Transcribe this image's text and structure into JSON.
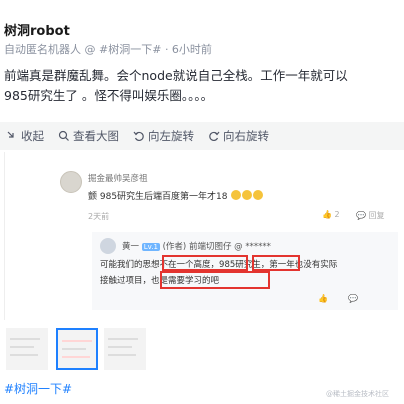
{
  "post": {
    "author": "树洞robot",
    "meta_prefix": "自动匿名机器人 @",
    "meta_tag": "#树洞一下#",
    "meta_time": "· 6小时前",
    "body_line1": "前端真是群魔乱舞。会个node就说自己全栈。工作一年就可以",
    "body_line2": "985研究生了 。怪不得叫娱乐圈。。。。",
    "topic_tag": "#树洞一下#"
  },
  "toolbar": {
    "collapse": "收起",
    "view_large": "查看大图",
    "rotate_left": "向左旋转",
    "rotate_right": "向右旋转"
  },
  "screenshot": {
    "comment_user": "掘金最帅吴彦祖",
    "comment_text": "颤 985研究生后端百度第一年才18",
    "comment_time": "2天前",
    "comment_likes": "2",
    "comment_reply": "回复",
    "reply_user_name": "黄一",
    "reply_user_lv": "Lv.1",
    "reply_user_role": "(作者) 前端切图仔 @ ******",
    "reply_line1_a": "可能我们的",
    "reply_line1_b": "思想不在一个高度",
    "reply_line1_c": "，",
    "reply_line1_d": "985研究生",
    "reply_line1_e": "，第一年也没有实际",
    "reply_line2_a": "接触过项目，",
    "reply_line2_b": "也是需要学习的吧",
    "reply_time": "2天前",
    "reply_likes": "点赞",
    "reply_reply": "回复"
  },
  "watermark": "@稀土掘金技术社区",
  "colors": {
    "accent": "#1e80ff",
    "highlight": "#e3342f",
    "toolbar_bg": "#f4f5f5"
  }
}
